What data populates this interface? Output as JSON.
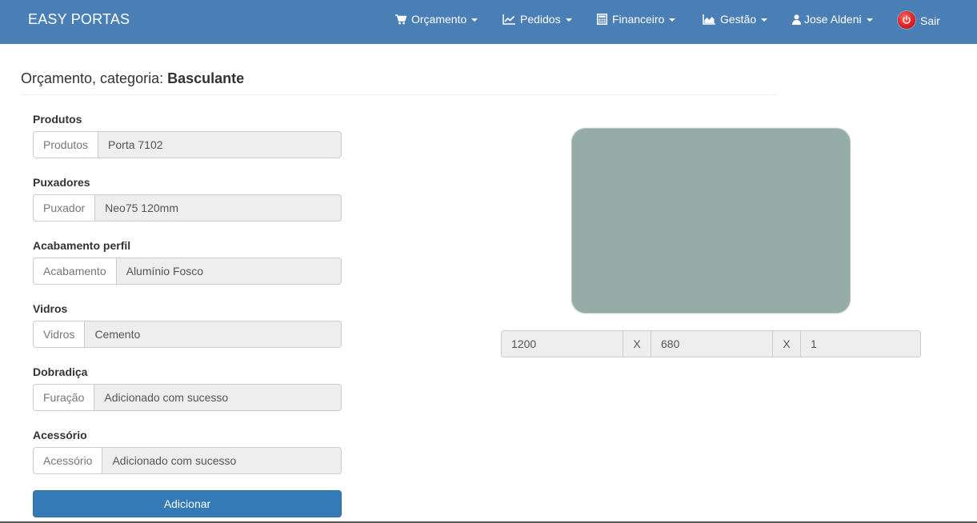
{
  "navbar": {
    "brand": "EASY PORTAS",
    "items": [
      {
        "label": "Orçamento",
        "icon": "cart-icon"
      },
      {
        "label": "Pedidos",
        "icon": "line-chart-icon"
      },
      {
        "label": "Financeiro",
        "icon": "calculator-icon"
      },
      {
        "label": "Gestão",
        "icon": "area-chart-icon"
      },
      {
        "label": "Jose Aldeni",
        "icon": "user-icon"
      }
    ],
    "logout_label": "Sair"
  },
  "page": {
    "title_prefix": "Orçamento, categoria:",
    "title_category": "Basculante"
  },
  "form": {
    "fields": [
      {
        "label": "Produtos",
        "addon": "Produtos",
        "value": "Porta 7102"
      },
      {
        "label": "Puxadores",
        "addon": "Puxador",
        "value": "Neo75 120mm"
      },
      {
        "label": "Acabamento perfil",
        "addon": "Acabamento",
        "value": "Alumínio Fosco"
      },
      {
        "label": "Vidros",
        "addon": "Vidros",
        "value": "Cemento"
      },
      {
        "label": "Dobradiça",
        "addon": "Furação",
        "value": "Adicionado com sucesso"
      },
      {
        "label": "Acessório",
        "addon": "Acessório",
        "value": "Adicionado com sucesso"
      }
    ],
    "submit_label": "Adicionar"
  },
  "preview": {
    "fill_color": "#94aba6",
    "width": "1200",
    "separator_1": "X",
    "height": "680",
    "separator_2": "X",
    "quantity": "1"
  },
  "colors": {
    "navbar": "#4a7fb5",
    "primary_button": "#337ab7"
  }
}
